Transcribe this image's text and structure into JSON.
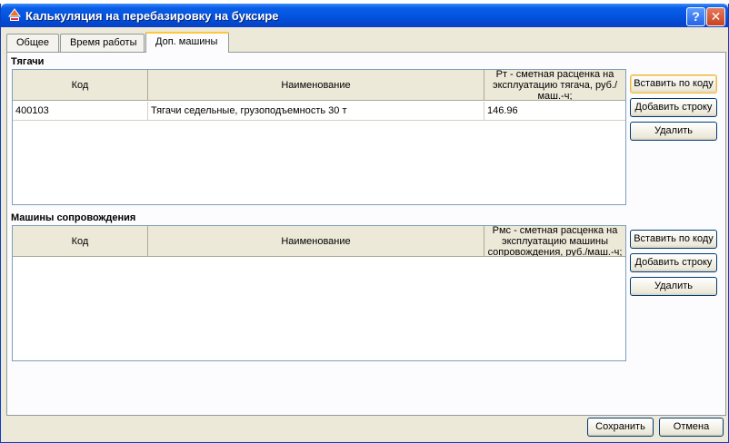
{
  "window": {
    "title": "Калькуляция на перебазировку на буксире",
    "help_label": "?",
    "close_label": "✕"
  },
  "tabs": [
    {
      "label": "Общее"
    },
    {
      "label": "Время работы"
    },
    {
      "label": "Доп. машины"
    }
  ],
  "tractors": {
    "label": "Тягачи",
    "columns": [
      "Код",
      "Наименование",
      "Рт - сметная расценка на эксплуатацию тягача, руб./маш.-ч;"
    ],
    "rows": [
      {
        "code": "400103",
        "name": "Тягачи седельные, грузоподъемность 30 т",
        "rate": "146.96"
      }
    ],
    "buttons": {
      "insert": "Вставить по коду",
      "add_row": "Добавить строку",
      "delete": "Удалить"
    }
  },
  "escort": {
    "label": "Машины сопровождения",
    "columns": [
      "Код",
      "Наименование",
      "Рмс - сметная расценка на эксплуатацию машины сопровождения, руб./маш.-ч;"
    ],
    "rows": [],
    "buttons": {
      "insert": "Вставить по коду",
      "add_row": "Добавить строку",
      "delete": "Удалить"
    }
  },
  "footer": {
    "save": "Сохранить",
    "cancel": "Отмена"
  }
}
